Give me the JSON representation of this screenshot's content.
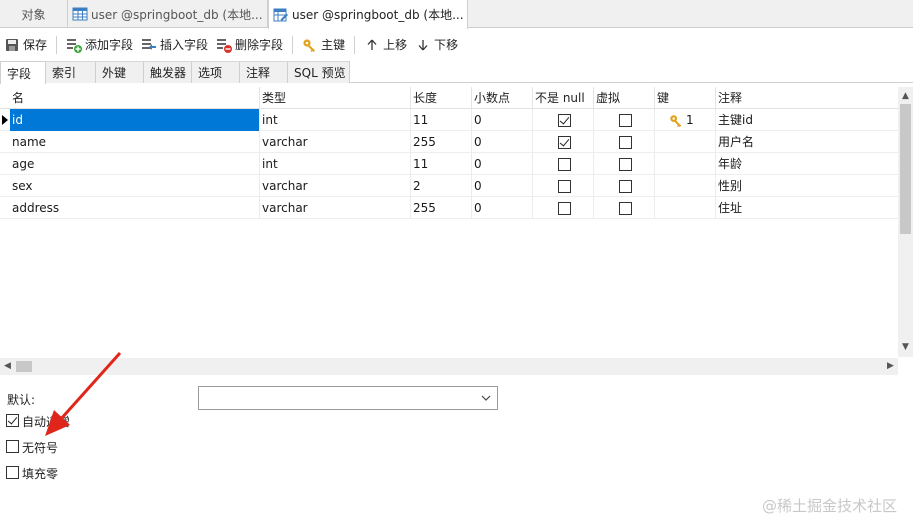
{
  "window_tabs": [
    {
      "label": "对象",
      "icon": "none"
    },
    {
      "label": "user @springboot_db (本地...",
      "icon": "table-icon"
    },
    {
      "label": "user @springboot_db (本地...",
      "icon": "table-design-icon"
    }
  ],
  "toolbar": {
    "save": "保存",
    "add_field": "添加字段",
    "insert_field": "插入字段",
    "delete_field": "删除字段",
    "primary_key": "主键",
    "move_up": "上移",
    "move_down": "下移"
  },
  "subtabs": [
    "字段",
    "索引",
    "外键",
    "触发器",
    "选项",
    "注释",
    "SQL 预览"
  ],
  "grid": {
    "columns": [
      "名",
      "类型",
      "长度",
      "小数点",
      "不是 null",
      "虚拟",
      "键",
      "注释"
    ],
    "rows": [
      {
        "name": "id",
        "type": "int",
        "length": "11",
        "decimals": "0",
        "not_null": true,
        "virtual": false,
        "key": "1",
        "comment": "主键id"
      },
      {
        "name": "name",
        "type": "varchar",
        "length": "255",
        "decimals": "0",
        "not_null": true,
        "virtual": false,
        "key": "",
        "comment": "用户名"
      },
      {
        "name": "age",
        "type": "int",
        "length": "11",
        "decimals": "0",
        "not_null": false,
        "virtual": false,
        "key": "",
        "comment": "年龄"
      },
      {
        "name": "sex",
        "type": "varchar",
        "length": "2",
        "decimals": "0",
        "not_null": false,
        "virtual": false,
        "key": "",
        "comment": "性别"
      },
      {
        "name": "address",
        "type": "varchar",
        "length": "255",
        "decimals": "0",
        "not_null": false,
        "virtual": false,
        "key": "",
        "comment": "住址"
      }
    ],
    "selected_row": 0
  },
  "props": {
    "default_label": "默认:",
    "default_value": "",
    "auto_increment_label": "自动递增",
    "auto_increment": true,
    "unsigned_label": "无符号",
    "unsigned": false,
    "zerofill_label": "填充零",
    "zerofill": false
  },
  "annotation_color": "#e0261b",
  "watermark": "@稀土掘金技术社区"
}
